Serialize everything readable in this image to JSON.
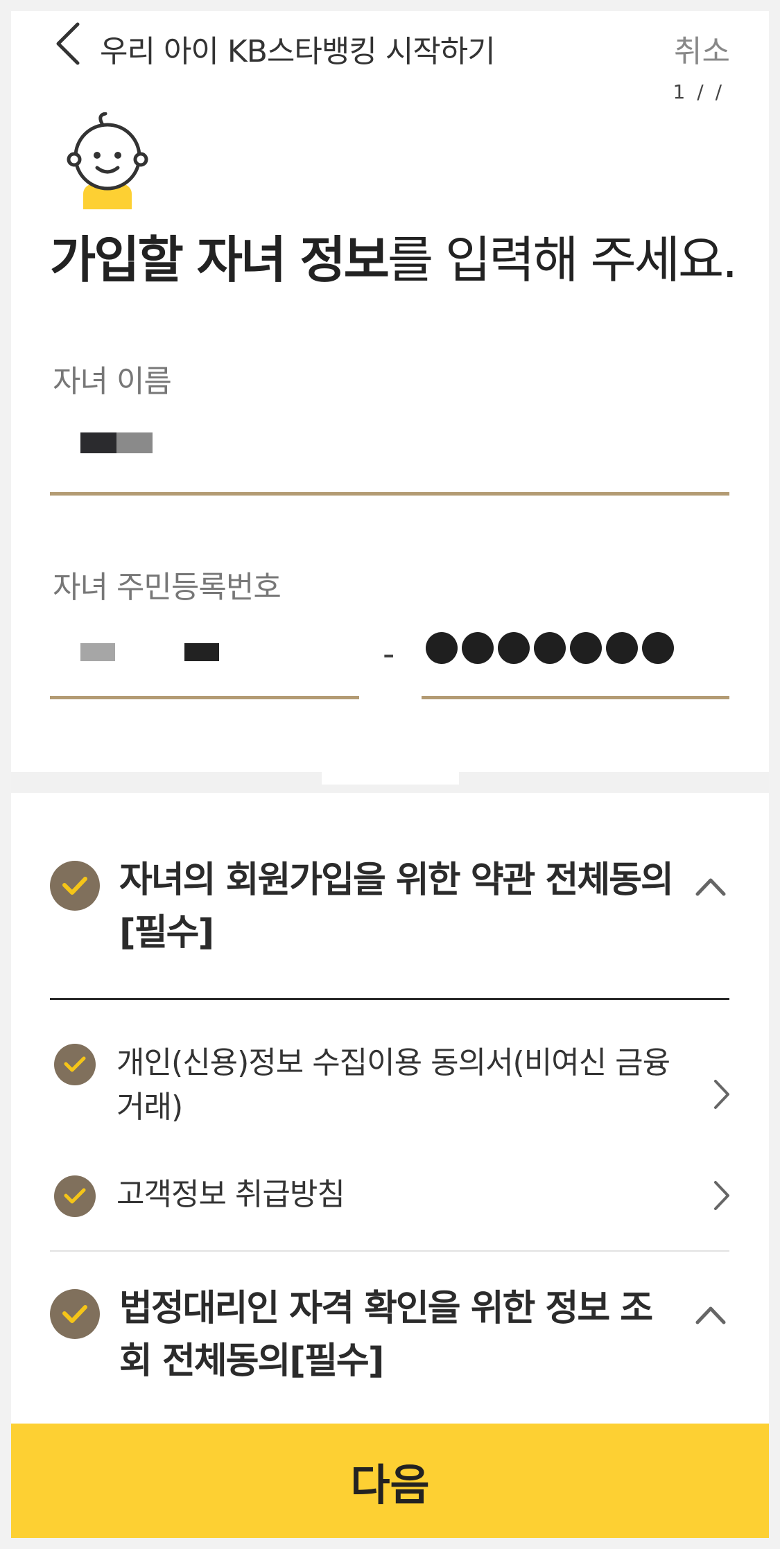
{
  "header": {
    "title": "우리 아이 KB스타뱅킹 시작하기",
    "cancel_label": "취소",
    "step": "1 / /"
  },
  "intro": {
    "title_bold": "가입할 자녀 정보",
    "title_rest": "를 입력해 주세요."
  },
  "form": {
    "child_name_label": "자녀 이름",
    "child_rrn_label": "자녀 주민등록번호",
    "rrn_separator": "-",
    "rrn_back_masked_count": 7
  },
  "agreements": {
    "group1": {
      "title": "자녀의 회원가입을 위한 약관 전체동의[필수]",
      "items": [
        {
          "label": "개인(신용)정보 수집이용 동의서(비여신 금융거래)"
        },
        {
          "label": "고객정보 취급방침"
        }
      ]
    },
    "group2": {
      "title": "법정대리인 자격 확인을 위한 정보 조회 전체동의[필수]"
    }
  },
  "footer": {
    "next_label": "다음"
  },
  "colors": {
    "accent_yellow": "#fdd033",
    "underline_gold": "#b39b73",
    "check_brown": "#80705c",
    "check_mark": "#f5c518"
  }
}
